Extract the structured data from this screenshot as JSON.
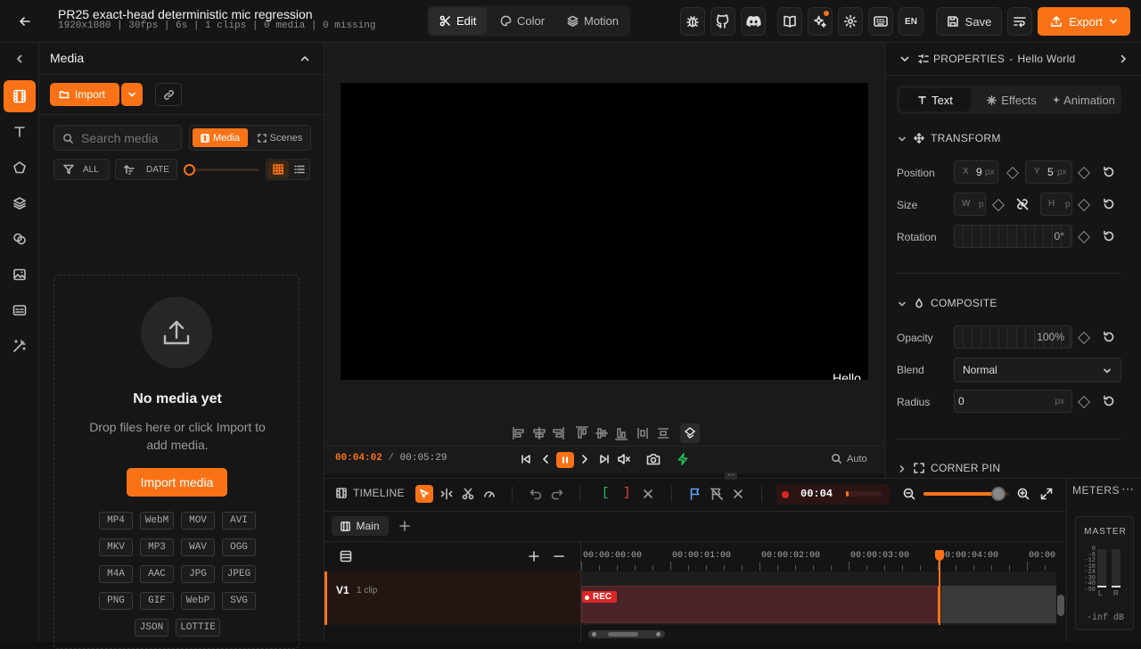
{
  "project": {
    "title": "PR25 exact-head deterministic mic regression",
    "meta": "1920x1080 | 30fps | 6s | 1 clips | 0 media | 0 missing"
  },
  "modes": [
    {
      "label": "Edit"
    },
    {
      "label": "Color"
    },
    {
      "label": "Motion"
    }
  ],
  "top_actions": {
    "lang": "EN",
    "save": "Save",
    "export": "Export"
  },
  "media": {
    "title": "Media",
    "import": "Import",
    "search_placeholder": "Search media",
    "tab_media": "Media",
    "tab_scenes": "Scenes",
    "filter_all": "ALL",
    "sort_date": "DATE",
    "empty_title": "No media yet",
    "empty_hint": "Drop files here or click Import to add media.",
    "import_media": "Import media",
    "formats": [
      "MP4",
      "WebM",
      "MOV",
      "AVI",
      "MKV",
      "MP3",
      "WAV",
      "OGG",
      "M4A",
      "AAC",
      "JPG",
      "JPEG",
      "PNG",
      "GIF",
      "WebP",
      "SVG",
      "JSON",
      "LOTTIE"
    ]
  },
  "preview": {
    "overlay_text": "Hello",
    "time_current": "00:04:02",
    "time_sep": "/",
    "time_total": "00:05:29",
    "zoom": "Auto"
  },
  "properties": {
    "header": "PROPERTIES",
    "sep": "-",
    "target": "Hello World",
    "tabs": [
      "Text",
      "Effects",
      "Animation"
    ],
    "transform": {
      "title": "TRANSFORM",
      "position_label": "Position",
      "x_prefix": "X",
      "x_value": "9",
      "x_unit": "px",
      "y_prefix": "Y",
      "y_value": "5",
      "y_unit": "px",
      "size_label": "Size",
      "w_prefix": "W",
      "w_unit": "p",
      "h_prefix": "H",
      "h_unit": "p",
      "rotation_label": "Rotation",
      "rotation_value": "0°"
    },
    "composite": {
      "title": "COMPOSITE",
      "opacity_label": "Opacity",
      "opacity_value": "100%",
      "blend_label": "Blend",
      "blend_value": "Normal",
      "radius_label": "Radius",
      "radius_value": "0",
      "radius_unit": "px"
    },
    "corner_pin": "CORNER PIN"
  },
  "timeline": {
    "title": "TIMELINE",
    "in_mark": "[",
    "out_mark": "]",
    "record_time": "00:04",
    "zoom_level": 0.88,
    "tab": "Main",
    "track_name": "V1",
    "track_info": "1 clip",
    "clip_badge": "REC",
    "ruler": [
      "00:00:00:00",
      "00:00:01:00",
      "00:00:02:00",
      "00:00:03:00",
      "00:00:04:00",
      "00:00:"
    ],
    "playhead": "00:00:04:00"
  },
  "meters": {
    "title": "METERS",
    "master": "MASTER",
    "scale": [
      "0",
      "-6",
      "-12",
      "-18",
      "-24",
      "-30",
      "-40",
      "-50"
    ],
    "left": "L",
    "right": "R",
    "readout": "-inf dB"
  },
  "colors": {
    "accent": "#f97316",
    "record": "#dc2626"
  }
}
